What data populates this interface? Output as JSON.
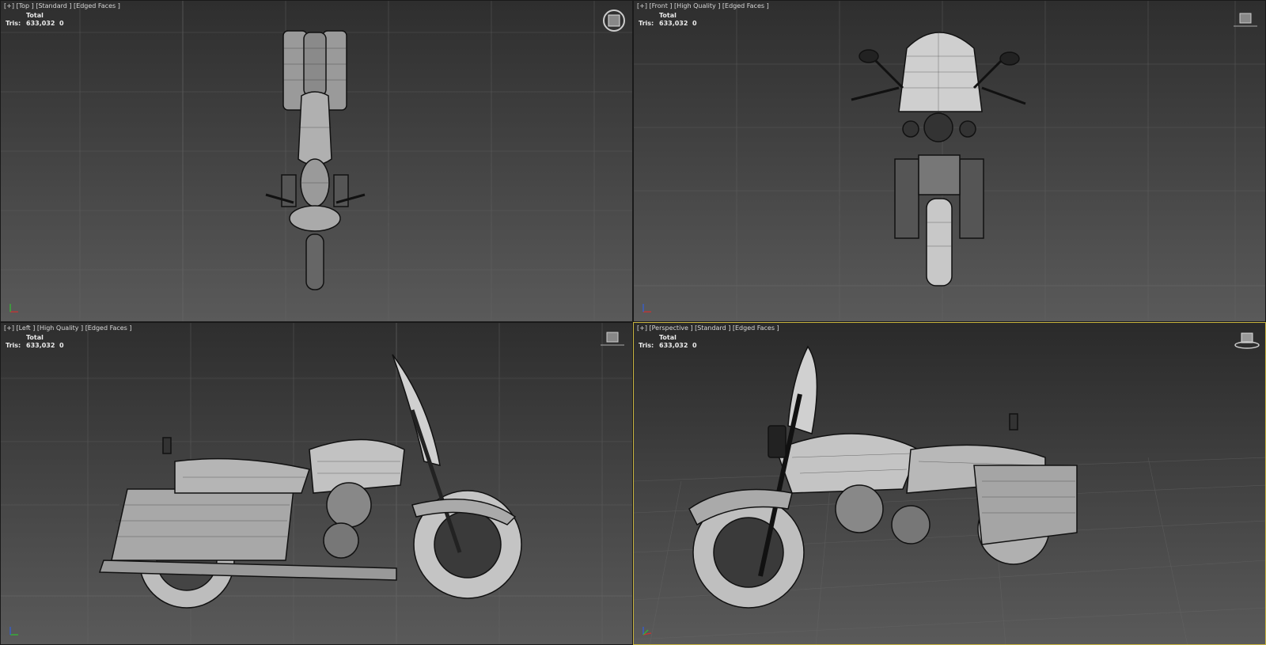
{
  "viewports": [
    {
      "id": "top",
      "label": "[+] [Top ] [Standard ] [Edged Faces ]",
      "stats": {
        "header": "Total",
        "key": "Tris:",
        "value": "633,032",
        "selected": "0"
      },
      "nav_widget": "viewcube-icon",
      "active": false
    },
    {
      "id": "front",
      "label": "[+] [Front ] [High Quality ] [Edged Faces ]",
      "stats": {
        "header": "Total",
        "key": "Tris:",
        "value": "633,032",
        "selected": "0"
      },
      "nav_widget": "viewcube-icon",
      "active": false
    },
    {
      "id": "left",
      "label": "[+] [Left ] [High Quality ] [Edged Faces ]",
      "stats": {
        "header": "Total",
        "key": "Tris:",
        "value": "633,032",
        "selected": "0"
      },
      "nav_widget": "viewcube-icon",
      "active": false
    },
    {
      "id": "perspective",
      "label": "[+] [Perspective ] [Standard ] [Edged Faces ]",
      "stats": {
        "header": "Total",
        "key": "Tris:",
        "value": "633,032",
        "selected": "0"
      },
      "nav_widget": "viewcube-icon",
      "active": true
    }
  ],
  "colors": {
    "viewport_bg_top": "#2f2f2f",
    "viewport_bg_bottom": "#585858",
    "grid": "#6a6a6a",
    "active_border": "#c8b440",
    "axis_x": "#d03030",
    "axis_y": "#30c030",
    "axis_z": "#3060e0"
  }
}
